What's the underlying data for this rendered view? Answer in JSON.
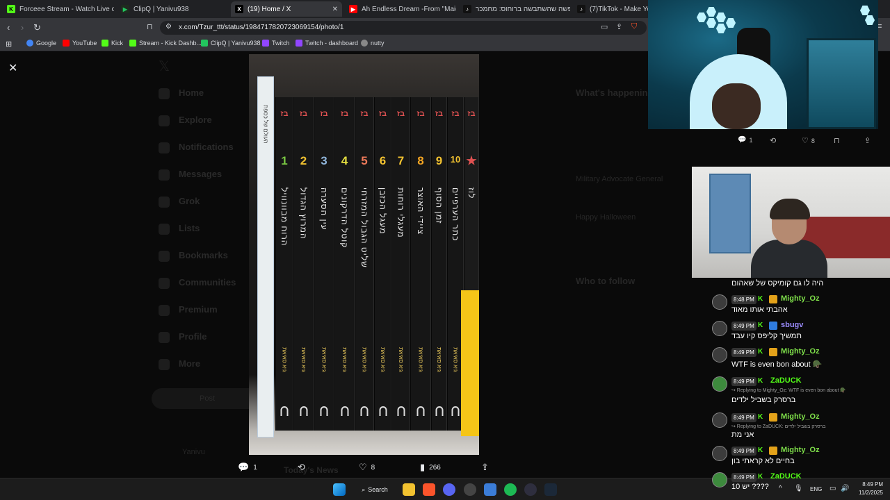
{
  "browser": {
    "tabs": [
      {
        "label": "Forceee Stream - Watch Live on Kick",
        "fav_color": "#53fc18",
        "fav_glyph": "K"
      },
      {
        "label": "ClipQ | Yanivu938",
        "fav_color": "#22c55e",
        "fav_glyph": "▶"
      },
      {
        "label": "(19) Home / X",
        "fav_color": "#000000",
        "fav_glyph": "X"
      },
      {
        "label": "Ah Endless Dream -From \"Maiden's F",
        "fav_color": "#ff0000",
        "fav_glyph": "▶"
      },
      {
        "label": "הרופשה שהשתבשה ברוחוס: מחמכר",
        "fav_color": "#111111",
        "fav_glyph": "♪"
      },
      {
        "label": "(7)TikTok - Make Your Da",
        "fav_color": "#111111",
        "fav_glyph": "♪"
      }
    ],
    "url": "x.com/Tzur_ttt/status/1984717820723069154/photo/1",
    "bookmarks": [
      {
        "label": "Google",
        "color": "#4285f4"
      },
      {
        "label": "YouTube",
        "color": "#ff0000"
      },
      {
        "label": "Kick",
        "color": "#53fc18"
      },
      {
        "label": "Stream - Kick Dashb...",
        "color": "#53fc18"
      },
      {
        "label": "ClipQ | Yanivu938",
        "color": "#22c55e"
      },
      {
        "label": "Twitch",
        "color": "#9146ff"
      },
      {
        "label": "Twitch - dashboard",
        "color": "#9146ff"
      },
      {
        "label": "nutty",
        "color": "#888888"
      }
    ]
  },
  "x_sidebar": {
    "items": [
      "Home",
      "Explore",
      "Notifications",
      "Messages",
      "Grok",
      "Lists",
      "Bookmarks",
      "Communities",
      "Premium",
      "Profile",
      "More"
    ],
    "post_button": "Post",
    "account": "Yanivu"
  },
  "x_right": {
    "heading": "What's happening",
    "trend1": "Military Advocate General",
    "trend2": "Happy Halloween",
    "who_to_follow": "Who to follow",
    "news": "Today's News"
  },
  "photo": {
    "books": [
      {
        "num": "1",
        "color": "#7ac943",
        "title": "הרוח מבוונוויל"
      },
      {
        "num": "2",
        "color": "#f2c230",
        "title": "המרוץ הגדול"
      },
      {
        "num": "3",
        "color": "#8fb4d9",
        "title": "עין הסערה"
      },
      {
        "num": "4",
        "color": "#e6e040",
        "title": "קוטל הדרקונים"
      },
      {
        "num": "5",
        "color": "#f07a5a",
        "title": "שליט הגבול המזרחי"
      },
      {
        "num": "6",
        "color": "#f2c230",
        "title": "מעגל הכזבן"
      },
      {
        "num": "7",
        "color": "#f2c230",
        "title": "מעגלי רוחות"
      },
      {
        "num": "8",
        "color": "#f5a623",
        "title": "ציידי האוצר"
      },
      {
        "num": "9",
        "color": "#f2c230",
        "title": "זמן הסוף"
      },
      {
        "num": "10",
        "color": "#f2c230",
        "title": "כתר הערפיים"
      },
      {
        "num": "★",
        "color": "#e05252",
        "title": "לוז"
      }
    ],
    "author": "גיא סאיאת",
    "left_book_title": "העולם של כספת"
  },
  "post_actions": {
    "replies": "1",
    "reposts": "",
    "likes": "8",
    "views": "266"
  },
  "cam_actions": {
    "replies": "1",
    "likes": "8"
  },
  "chat": [
    {
      "time": "",
      "user": "",
      "user_color": "#ffffff",
      "reply": "",
      "text": "היה לו גם קומיקס של שאהום"
    },
    {
      "time": "8:48 PM",
      "user": "Mighty_Oz",
      "user_color": "#7fe04a",
      "reply": "",
      "text": "אהבתי אותו מאוד"
    },
    {
      "time": "8:49 PM",
      "user": "sbugv",
      "user_color": "#9b8cff",
      "reply": "",
      "text": "תמשיך קליפס קיו עבד"
    },
    {
      "time": "8:49 PM",
      "user": "Mighty_Oz",
      "user_color": "#7fe04a",
      "reply": "",
      "text": "WTF is even bon about 🪖"
    },
    {
      "time": "8:49 PM",
      "user": "ZaDUCK",
      "user_color": "#53fc18",
      "reply": "↪ Replying to Mighty_Oz: WTF is even bon about 🪖",
      "text": "ברסרק בשביל ילדים"
    },
    {
      "time": "8:49 PM",
      "user": "Mighty_Oz",
      "user_color": "#7fe04a",
      "reply": "↪ Replying to ZaDUCK: ברסרק בשביל ילדים",
      "text": "אני מת"
    },
    {
      "time": "8:49 PM",
      "user": "Mighty_Oz",
      "user_color": "#7fe04a",
      "reply": "",
      "text": "בחיים לא קראתי בון"
    },
    {
      "time": "8:49 PM",
      "user": "ZaDUCK",
      "user_color": "#53fc18",
      "reply": "",
      "text": "יש 10 ????"
    }
  ],
  "taskbar": {
    "search": "Search",
    "lang": "ENG",
    "time": "8:49 PM",
    "date": "11/2/2025"
  }
}
